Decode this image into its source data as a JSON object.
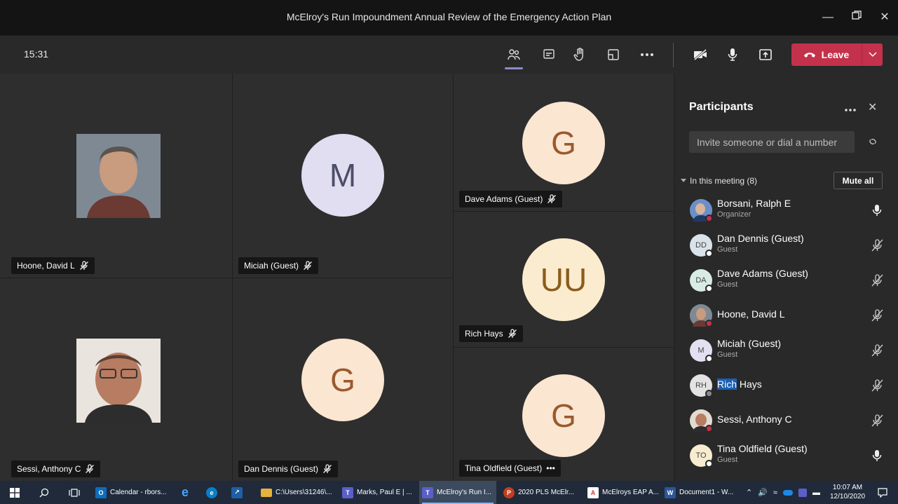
{
  "window": {
    "title": "McElroy's Run Impoundment Annual Review of the Emergency Action Plan"
  },
  "toolbar": {
    "time": "15:31",
    "leave_label": "Leave"
  },
  "tiles": [
    {
      "name": "Hoone, David L",
      "initials": "",
      "avatar_bg": "#6f7a86"
    },
    {
      "name": "Miciah (Guest)",
      "initials": "M",
      "avatar_bg": "#e0def0",
      "text_color": "#4d4d6a"
    },
    {
      "name": "Dave Adams (Guest)",
      "initials": "G",
      "avatar_bg": "#fbe6d2",
      "text_color": "#9a5a2e"
    },
    {
      "name": "Rich Hays",
      "initials": "UU",
      "avatar_bg": "#fbeccf",
      "text_color": "#8a5d1c"
    },
    {
      "name": "Sessi, Anthony C",
      "initials": "",
      "avatar_bg": "#9a6f5c"
    },
    {
      "name": "Dan Dennis (Guest)",
      "initials": "G",
      "avatar_bg": "#fbe6d2",
      "text_color": "#9a5a2e"
    },
    {
      "name": "Tina Oldfield (Guest)",
      "initials": "G",
      "avatar_bg": "#fbe6d2",
      "text_color": "#9a5a2e",
      "more": "•••"
    }
  ],
  "panel": {
    "title": "Participants",
    "invite_placeholder": "Invite someone or dial a number",
    "section_label": "In this meeting (8)",
    "mute_all": "Mute all",
    "participants": [
      {
        "name": "Borsani, Ralph E",
        "role": "Organizer",
        "initials": "",
        "avatar_bg": "#5a78b0",
        "status": "#c4314b",
        "mic": "on"
      },
      {
        "name": "Dan Dennis (Guest)",
        "role": "Guest",
        "initials": "DD",
        "avatar_bg": "#dbe3ea",
        "status": "#ffffff",
        "mic": "off"
      },
      {
        "name": "Dave Adams (Guest)",
        "role": "Guest",
        "initials": "DA",
        "avatar_bg": "#d8ebe4",
        "status": "#ffffff",
        "mic": "off"
      },
      {
        "name": "Hoone, David L",
        "role": "",
        "initials": "",
        "avatar_bg": "#7b838c",
        "status": "#c4314b",
        "mic": "off"
      },
      {
        "name": "Miciah (Guest)",
        "role": "Guest",
        "initials": "M",
        "avatar_bg": "#e3e0f1",
        "status": "#ffffff",
        "mic": "off"
      },
      {
        "name_highlight": "Rich",
        "name_rest": " Hays",
        "role": "",
        "initials": "RH",
        "avatar_bg": "#e3e3e3",
        "status": "#8a8a8a",
        "mic": "off"
      },
      {
        "name": "Sessi, Anthony C",
        "role": "",
        "initials": "",
        "avatar_bg": "#9b6f5a",
        "status": "#c4314b",
        "mic": "off"
      },
      {
        "name": "Tina Oldfield (Guest)",
        "role": "Guest",
        "initials": "TO",
        "avatar_bg": "#f7ecd0",
        "status": "#ffffff",
        "mic": "on"
      }
    ]
  },
  "taskbar": {
    "items": [
      {
        "label": "Calendar - rbors...",
        "icon": "outlook-icon",
        "color": "#0f6cbd",
        "glyph": "O"
      },
      {
        "label": "",
        "icon": "ie-icon",
        "color": "#1e88e5",
        "glyph": "e"
      },
      {
        "label": "",
        "icon": "edge-icon",
        "color": "#0a7ec8",
        "glyph": "e"
      },
      {
        "label": "",
        "icon": "app-icon",
        "color": "#1c5fa8",
        "glyph": "↗"
      },
      {
        "label": "C:\\Users\\31246\\...",
        "icon": "folder-icon",
        "color": "#e8b33b",
        "glyph": ""
      },
      {
        "label": "Marks, Paul E | ...",
        "icon": "teams-icon",
        "color": "#5b5fc7",
        "glyph": "T"
      },
      {
        "label": "McElroy's Run I...",
        "icon": "teams-icon",
        "color": "#5b5fc7",
        "glyph": "T",
        "active": true
      },
      {
        "label": "2020 PLS McElr...",
        "icon": "powerpoint-icon",
        "color": "#c43e1c",
        "glyph": "P"
      },
      {
        "label": "McElroys EAP A...",
        "icon": "pdf-icon",
        "color": "#d83b2f",
        "glyph": "A"
      },
      {
        "label": "Document1 - W...",
        "icon": "word-icon",
        "color": "#2b579a",
        "glyph": "W"
      }
    ],
    "time": "10:07 AM",
    "date": "12/10/2020"
  }
}
